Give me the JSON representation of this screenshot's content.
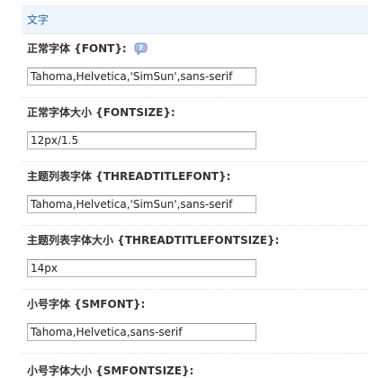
{
  "section": {
    "title": "文字"
  },
  "settings": [
    {
      "label": "正常字体 {FONT}:",
      "value": "Tahoma,Helvetica,'SimSun',sans-serif",
      "has_help": true,
      "help_icon": "help-bubble-icon"
    },
    {
      "label": "正常字体大小 {FONTSIZE}:",
      "value": "12px/1.5"
    },
    {
      "label": "主题列表字体 {THREADTITLEFONT}:",
      "value": "Tahoma,Helvetica,'SimSun',sans-serif"
    },
    {
      "label": "主题列表字体大小 {THREADTITLEFONTSIZE}:",
      "value": "14px"
    },
    {
      "label": "小号字体 {SMFONT}:",
      "value": "Tahoma,Helvetica,sans-serif"
    },
    {
      "label": "小号字体大小 {SMFONTSIZE}:"
    }
  ],
  "colors": {
    "header_bg": "#eef6fc",
    "header_text": "#2366a8",
    "help_icon": "#8fa7d6"
  }
}
